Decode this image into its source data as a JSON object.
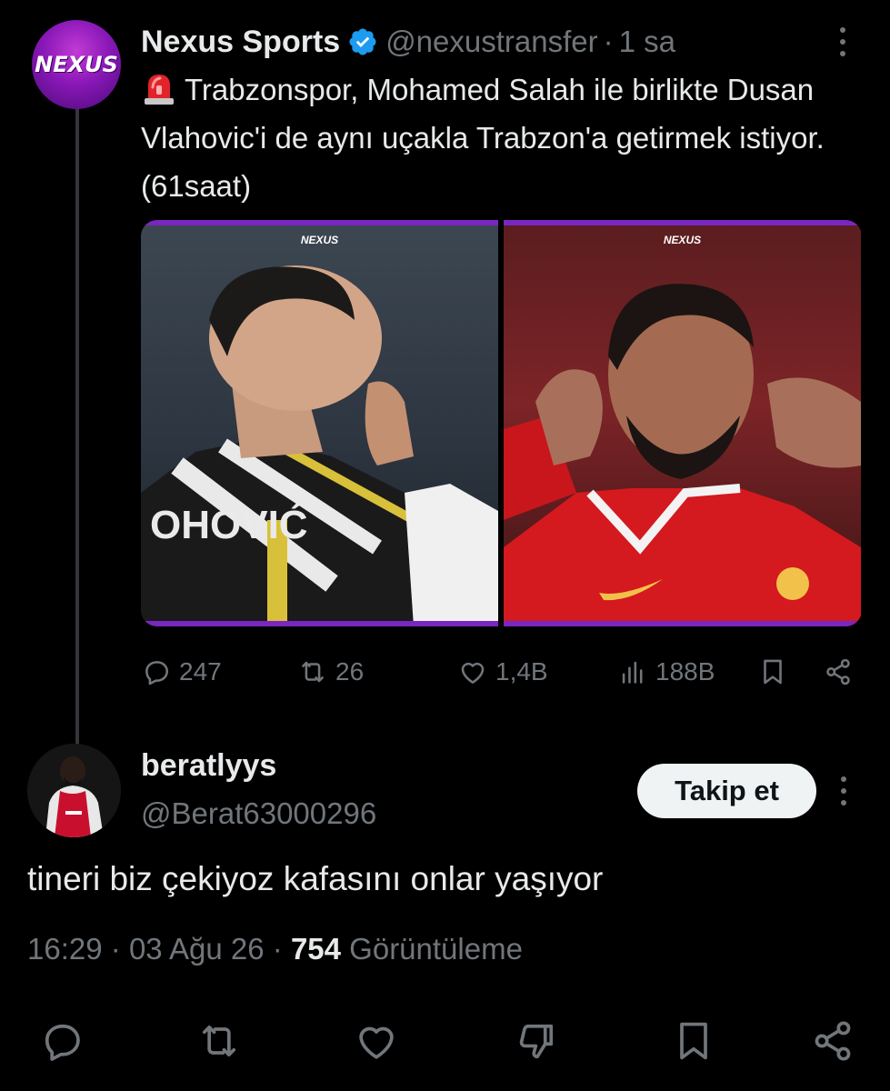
{
  "tweet": {
    "author_name": "Nexus Sports",
    "author_handle": "@nexustransfer",
    "separator": "·",
    "time": "1 sa",
    "avatar_logo": "NEXUS",
    "text": "Trabzonspor, Mohamed Salah ile birlikte Dusan Vlahovic'i de aynı uçakla Trabzon'a getirmek istiyor. (61saat)",
    "media_watermark": "NEXUS",
    "media": [
      {
        "icon": "photo-player-left"
      },
      {
        "icon": "photo-player-right"
      }
    ],
    "stats": {
      "replies": "247",
      "reposts": "26",
      "likes": "1,4B",
      "views": "188B"
    }
  },
  "reply": {
    "author_name": "beratlyys",
    "author_handle": "@Berat63000296",
    "follow_label": "Takip et",
    "text": "tineri biz çekiyoz kafasını onlar yaşıyor",
    "time": "16:29",
    "date": "03 Ağu 26",
    "separator": "·",
    "views_count": "754",
    "views_label": "Görüntüleme"
  },
  "colors": {
    "background": "#000000",
    "text_primary": "#e7e9ea",
    "text_secondary": "#71767b",
    "verified_blue": "#1d9bf0",
    "brand_purple": "#8a18b8"
  }
}
